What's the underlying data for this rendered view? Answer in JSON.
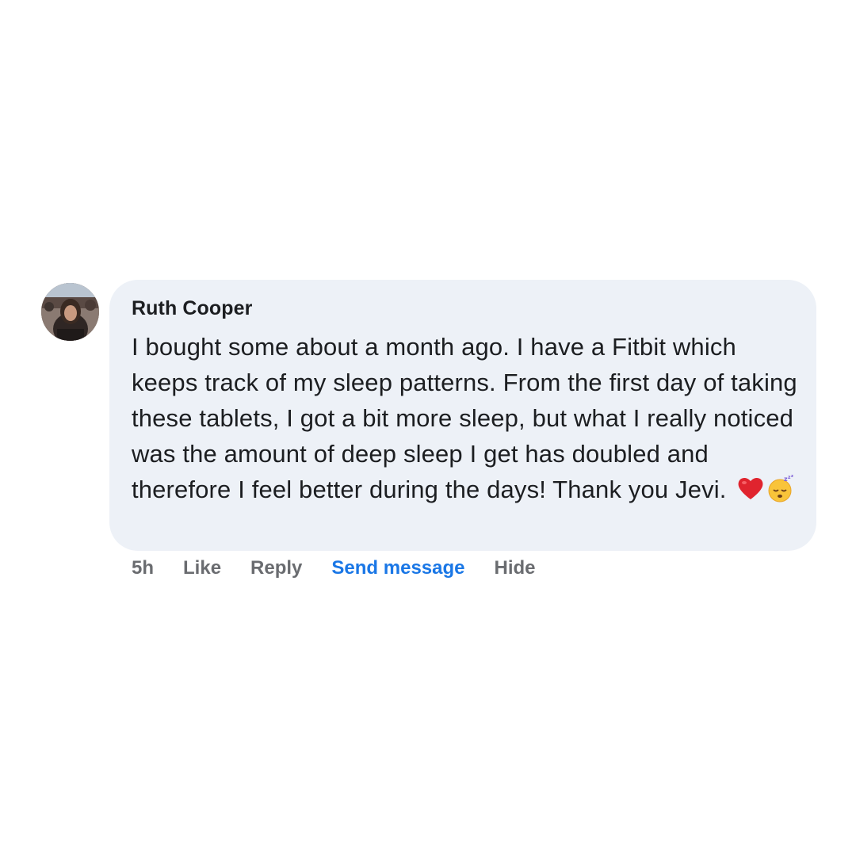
{
  "comment": {
    "author": "Ruth Cooper",
    "text": "I bought some about a month ago. I have a Fitbit which keeps track of my sleep patterns. From the first day of taking these tablets, I got a bit more sleep, but what I really noticed was the amount of deep sleep I get has doubled and therefore I feel better during the days! Thank you Jevi.",
    "emojis": [
      "red-heart-emoji",
      "sleeping-face-emoji"
    ],
    "avatar_icon": "avatar",
    "bubble_color": "#edf1f7"
  },
  "actions": {
    "time": "5h",
    "like": "Like",
    "reply": "Reply",
    "send_message": "Send message",
    "hide": "Hide",
    "send_message_color": "#1a77e6",
    "muted_color": "#6a6c70"
  }
}
